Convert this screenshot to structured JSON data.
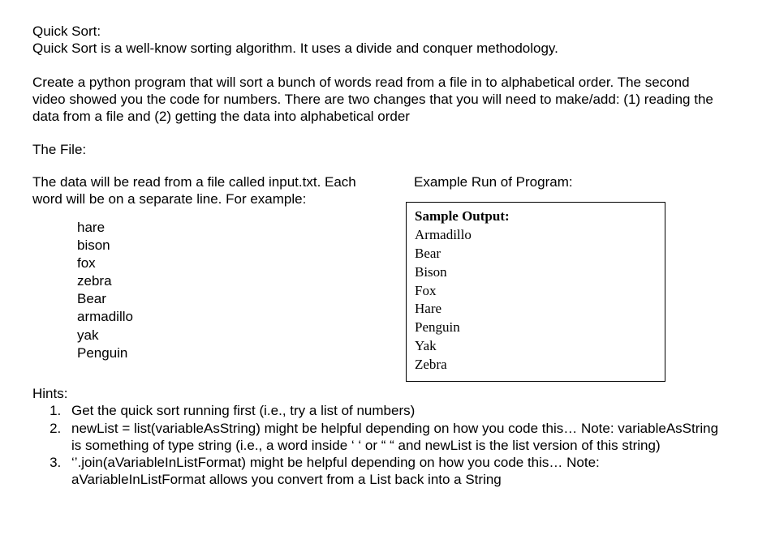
{
  "title": "Quick Sort:",
  "intro": "Quick Sort is a well-know sorting algorithm. It uses a divide and conquer methodology.",
  "task": "Create a python program that will sort a bunch of words read from a file in to alphabetical order. The second video showed you the code for numbers. There are two changes that you will need to make/add: (1) reading the data from a file and (2) getting the data into alphabetical order",
  "file_section_label": "The File:",
  "file_desc": "The data will be read from a file called input.txt. Each word will be on a separate line. For example:",
  "file_words": [
    "hare",
    "bison",
    "fox",
    "zebra",
    "Bear",
    "armadillo",
    "yak",
    "Penguin"
  ],
  "example_header": "Example Run of Program:",
  "output_label": "Sample Output:",
  "output_lines": [
    "Armadillo",
    "Bear",
    "Bison",
    "Fox",
    "Hare",
    "Penguin",
    "Yak",
    "Zebra"
  ],
  "hints_label": "Hints:",
  "hints": [
    "Get the quick sort running first (i.e., try a list of numbers)",
    "newList = list(variableAsString) might be helpful depending on how you code this… Note: variableAsString is something of type string (i.e., a word inside ‘ ‘ or “ “ and newList is the list version of this string)",
    "‘’.join(aVariableInListFormat) might be helpful depending on how you code this… Note: aVariableInListFormat allows you convert from a List back into a String"
  ]
}
